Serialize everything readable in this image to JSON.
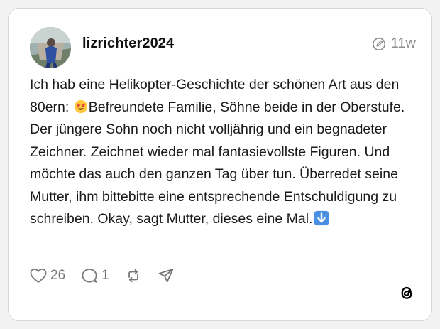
{
  "post": {
    "username": "lizrichter2024",
    "timestamp": "11w",
    "text_1": "Ich hab eine Helikopter-Geschichte der schönen Art aus den 80ern: ",
    "text_2": "Befreundete Familie, Söhne beide in der Oberstufe. Der jüngere Sohn noch nicht volljährig und ein begnadeter Zeichner. Zeichnet wieder mal fantasievollste Figuren. Und möchte das auch den ganzen Tag über tun. Überredet seine Mutter, ihm bittebitte eine entsprechende Entschuldigung zu schreiben. Okay, sagt Mutter, dieses eine Mal.",
    "likes": "26",
    "replies": "1"
  },
  "icons": {
    "edited": "edited-circle-pencil-icon",
    "emoji_1": "star-struck-emoji",
    "emoji_2": "down-arrow-emoji",
    "like": "heart-icon",
    "reply": "speech-bubble-icon",
    "repost": "repost-icon",
    "share": "paper-plane-icon",
    "brand": "threads-logo"
  },
  "colors": {
    "text": "#1a1a1a",
    "muted": "#8e8e8e",
    "border": "#d6d6d6",
    "arrow_emoji": "#4a90e2"
  }
}
